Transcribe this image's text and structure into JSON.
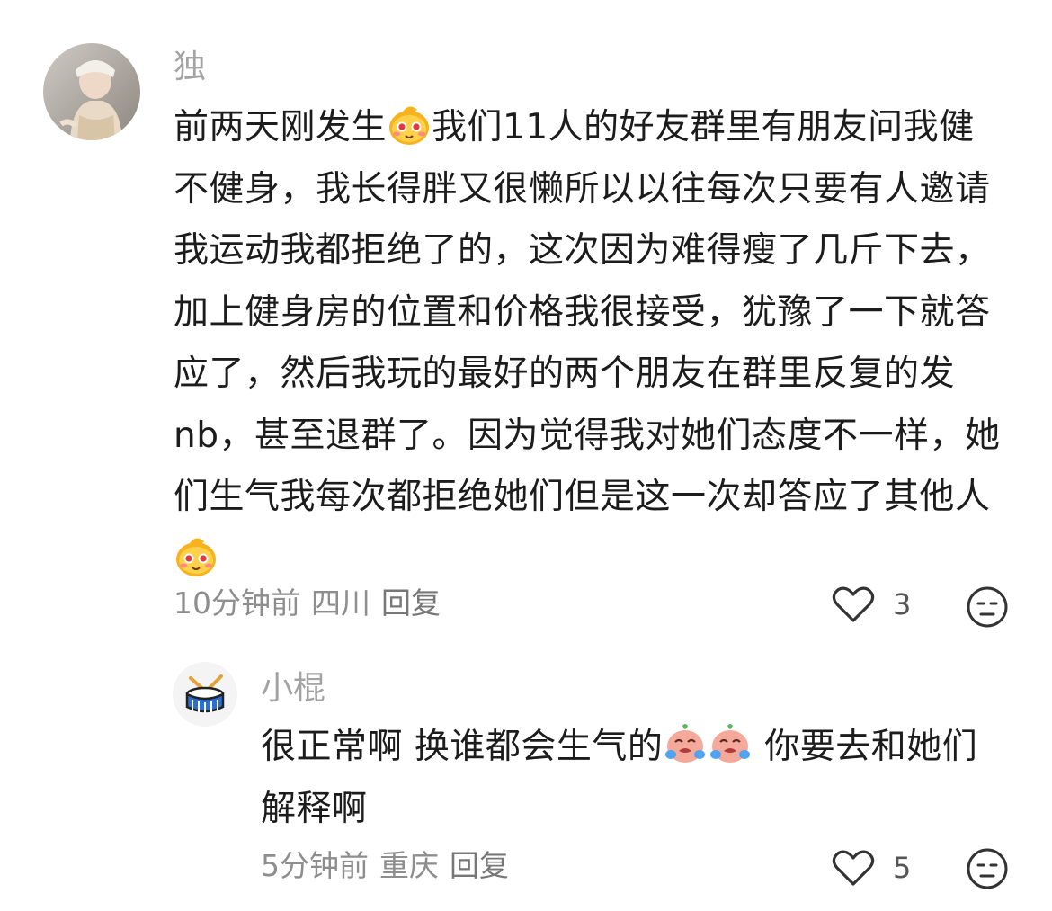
{
  "comments": [
    {
      "username": "独",
      "text_part1": "前两天刚发生",
      "text_part2": "我们11人的好友群里有朋友问我健不健身，我长得胖又很懒所以以往每次只要有人邀请我运动我都拒绝了的，这次因为难得瘦了几斤下去，加上健身房的位置和价格我很接受，犹豫了一下就答应了，然后我玩的最好的两个朋友在群里反复的发nb，甚至退群了。因为觉得我对她们态度不一样，她们生气我每次都拒绝她们但是这一次却答应了其他人",
      "time": "10分钟前",
      "location": "四川",
      "reply_label": "回复",
      "likes": "3",
      "emoji_name": "shy-face-emoji"
    },
    {
      "username": "小棍",
      "text_part1": "很正常啊 换谁都会生气的",
      "text_part2": " 你要去和她们解释啊",
      "time": "5分钟前",
      "location": "重庆",
      "reply_label": "回复",
      "likes": "5",
      "emoji_name": "crying-face-emoji"
    }
  ],
  "colors": {
    "username": "#a3a3a3",
    "meta": "#8e8e8e",
    "text": "#1c1c1c",
    "icon": "#333333"
  }
}
